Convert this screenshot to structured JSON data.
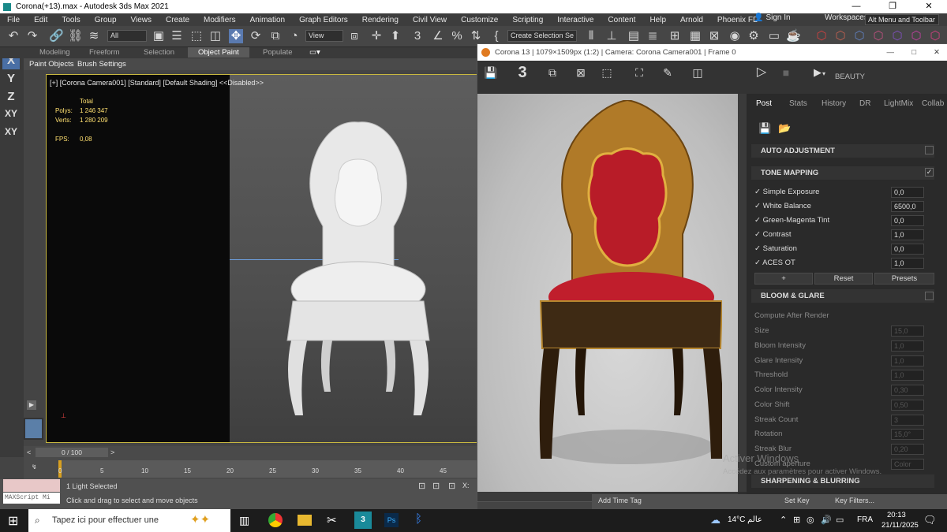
{
  "window": {
    "title": "Corona(+13).max - Autodesk 3ds Max 2021",
    "min": "—",
    "max": "❐",
    "close": "✕"
  },
  "menu": [
    "File",
    "Edit",
    "Tools",
    "Group",
    "Views",
    "Create",
    "Modifiers",
    "Animation",
    "Graph Editors",
    "Rendering",
    "Civil View",
    "Customize",
    "Scripting",
    "Interactive",
    "Content",
    "Help",
    "Arnold",
    "Phoenix FD"
  ],
  "signin": "Sign In",
  "workspaces_label": "Workspaces:",
  "workspace": "Alt Menu and Toolbar",
  "toolbar": {
    "filter": "All",
    "refcoord": "View",
    "selset": "Create Selection Se"
  },
  "ribbon_tabs": [
    "Modeling",
    "Freeform",
    "Selection",
    "Object Paint",
    "Populate"
  ],
  "ribbon_sub": [
    "Paint Objects",
    "Brush Settings"
  ],
  "axes": [
    "X",
    "Y",
    "Z",
    "XY",
    "XY"
  ],
  "viewport": {
    "label": "[+] [Corona Camera001] [Standard] [Default Shading]",
    "disabled": "<<Disabled>>",
    "stats_head": "Total",
    "polys_label": "Polys:",
    "polys": "1 246 347",
    "verts_label": "Verts:",
    "verts": "1 280 209",
    "fps_label": "FPS:",
    "fps": "0,08"
  },
  "timeline": {
    "frame": "0 / 100",
    "ticks": [
      "0",
      "5",
      "10",
      "15",
      "20",
      "25",
      "30",
      "35",
      "40",
      "45"
    ]
  },
  "status": {
    "maxscript": "MAXScript Mi",
    "selected": "1 Light Selected",
    "prompt": "Click and drag to select and move objects",
    "addtag": "Add Time Tag",
    "setkey": "Set Key",
    "keyfilters": "Key Filters..."
  },
  "vfb": {
    "title": "Corona 13 | 1079×1509px (1:2) | Camera: Corona Camera001 | Frame 0",
    "beauty": "BEAUTY"
  },
  "panel": {
    "tabs": [
      "Post",
      "Stats",
      "History",
      "DR",
      "LightMix",
      "Collab"
    ],
    "auto": "AUTO ADJUSTMENT",
    "tone": "TONE MAPPING",
    "tone_rows": [
      {
        "label": "Simple Exposure",
        "value": "0,0"
      },
      {
        "label": "White Balance",
        "value": "6500,0"
      },
      {
        "label": "Green-Magenta Tint",
        "value": "0,0"
      },
      {
        "label": "Contrast",
        "value": "1,0"
      },
      {
        "label": "Saturation",
        "value": "0,0"
      },
      {
        "label": "ACES OT",
        "value": "1,0"
      }
    ],
    "btn_plus": "+",
    "btn_reset": "Reset",
    "btn_presets": "Presets",
    "bloom": "BLOOM & GLARE",
    "bloom_rows": [
      {
        "label": "Compute After Render",
        "value": ""
      },
      {
        "label": "Size",
        "value": "15,0"
      },
      {
        "label": "Bloom Intensity",
        "value": "1,0"
      },
      {
        "label": "Glare Intensity",
        "value": "1,0"
      },
      {
        "label": "Threshold",
        "value": "1,0"
      },
      {
        "label": "Color Intensity",
        "value": "0,30"
      },
      {
        "label": "Color Shift",
        "value": "0,50"
      },
      {
        "label": "Streak Count",
        "value": "3"
      },
      {
        "label": "Rotation",
        "value": "15,0°"
      },
      {
        "label": "Streak Blur",
        "value": "0,20"
      },
      {
        "label": "Custom aperture",
        "value": "Color"
      }
    ],
    "sharpen": "SHARPENING & BLURRING",
    "watermark1": "Activer Windows",
    "watermark2": "Accédez aux paramètres pour activer Windows."
  },
  "taskbar": {
    "search": "Tapez ici pour effectuer une",
    "weather": "14°C عالم",
    "lang": "FRA",
    "time": "20:13",
    "date": "21/11/2025"
  }
}
